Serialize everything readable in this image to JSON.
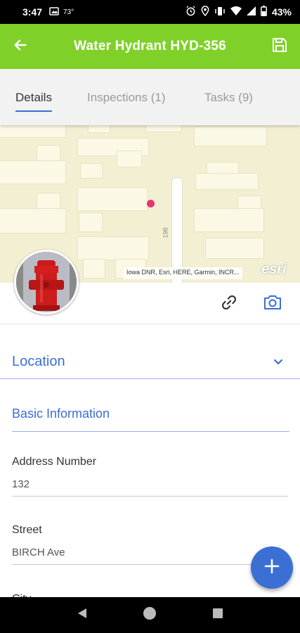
{
  "status_bar": {
    "time": "3:47",
    "temperature": "73°",
    "battery": "43%",
    "icons": [
      "photo-icon",
      "alarm-icon",
      "location-icon",
      "vibrate-icon",
      "wifi-icon",
      "signal-icon",
      "battery-icon"
    ]
  },
  "app_bar": {
    "title": "Water Hydrant HYD-356",
    "back_icon": "arrow-left-icon",
    "save_icon": "save-icon",
    "background_color": "#7fd12a"
  },
  "tabs": [
    {
      "label": "Details",
      "active": true
    },
    {
      "label": "Inspections (1)",
      "active": false
    },
    {
      "label": "Tasks (9)",
      "active": false
    }
  ],
  "map": {
    "attribution": "Iowa DNR, Esri, HERE, Garmin, INCR...",
    "logo": "esri",
    "road_label": "198",
    "pin_color": "#e8336f"
  },
  "actions": {
    "link_icon": "link-icon",
    "camera_icon": "camera-icon"
  },
  "sections": {
    "location": {
      "label": "Location",
      "icon": "chevron-down-icon"
    },
    "basic_information": {
      "label": "Basic Information"
    }
  },
  "fields": {
    "address_number": {
      "label": "Address Number",
      "value": "132"
    },
    "street": {
      "label": "Street",
      "value": "BIRCH Ave"
    },
    "city": {
      "label": "City"
    }
  },
  "fab": {
    "icon": "plus-icon"
  },
  "accent_color": "#3b6fd4"
}
